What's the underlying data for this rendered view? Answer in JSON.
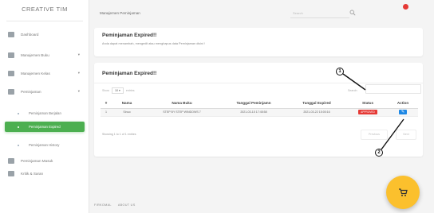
{
  "brand": "CREATIVE TIM",
  "sidebar": {
    "items": [
      {
        "label": "Dashboard",
        "caret": ""
      },
      {
        "label": "Manajemen Buku",
        "caret": "▾"
      },
      {
        "label": "Manajemen Kelas",
        "caret": "▾"
      },
      {
        "label": "Peminjaman",
        "caret": "▾"
      }
    ],
    "subitems": [
      {
        "label": "Peminjaman Berjalan"
      },
      {
        "label": "Peminjaman Expired",
        "active": true
      },
      {
        "label": "Peminjaman History"
      }
    ],
    "tail_items": [
      {
        "label": "Peminjaman Masuk"
      },
      {
        "label": "Kritik & Saran"
      }
    ]
  },
  "topbar": {
    "heading": "Manajemen Peminjaman",
    "search_placeholder": "Search"
  },
  "card1": {
    "title": "Peminjaman Expired!!",
    "text": "Anda dapat menambah, mengedit atau menghapus data Peminjaman disini !"
  },
  "card2": {
    "title": "Peminjaman Expired!!",
    "show_label": "Show",
    "show_value": "10 ▾",
    "entries_label": "entries",
    "search_label": "Search:",
    "columns": [
      "#",
      "Nama",
      "Nama Buku",
      "Tanggal Peminjamn",
      "Tanggal Expired",
      "Status",
      "Action"
    ],
    "rows": [
      {
        "no": "1",
        "nama": "Sinuo",
        "buku": "STEP BY STEP WINDOWS 7",
        "tgl_pinjam": "2021-03-15 17:45:58",
        "tgl_expired": "2021-03-22 15:00:16",
        "status": "APPROVED",
        "action": "✎"
      }
    ],
    "info": "Showing 1 to 1 of 1 entries",
    "prev_label": "Previous",
    "next_label": "Next"
  },
  "footer": {
    "links": [
      "FIRKOMAL",
      "ABOUT US"
    ]
  },
  "callouts": [
    "1",
    "2"
  ],
  "colors": {
    "active_green": "#4caf50",
    "status_red": "#e53935",
    "action_blue": "#1e88e5",
    "fab_yellow": "#fbc02d"
  },
  "icons": [
    "sidebar-item-icon",
    "search-icon",
    "notification-icon",
    "edit-icon",
    "cart-icon"
  ]
}
